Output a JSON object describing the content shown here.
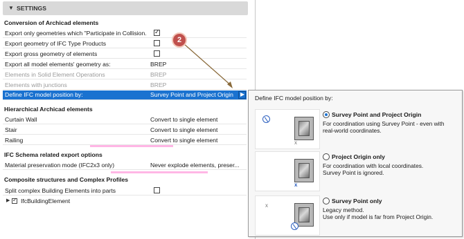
{
  "settings_header": {
    "title": "SETTINGS"
  },
  "groups": {
    "conversion": {
      "title": "Conversion of Archicad elements",
      "rows": [
        {
          "label": "Export only geometries which \"Participate in Collision...",
          "checkbox": true
        },
        {
          "label": "Export geometry of IFC Type Products",
          "checkbox": false
        },
        {
          "label": "Export gross geometry of elements",
          "checkbox": false
        },
        {
          "label": "Export all model elements' geometry as:",
          "value": "BREP"
        },
        {
          "label": "Elements in Solid Element Operations",
          "value": "BREP"
        },
        {
          "label": "Elements with junctions",
          "value": "BREP"
        },
        {
          "label": "Define IFC model position by:",
          "value": "Survey Point and Project Origin"
        }
      ]
    },
    "hierarchical": {
      "title": "Hierarchical Archicad elements",
      "rows": [
        {
          "label": "Curtain Wall",
          "value": "Convert to single element"
        },
        {
          "label": "Stair",
          "value": "Convert to single element"
        },
        {
          "label": "Railing",
          "value": "Convert to single element"
        }
      ]
    },
    "schema": {
      "title": "IFC Schema related export options",
      "rows": [
        {
          "label": "Material preservation mode (IFC2x3 only)",
          "value": "Never explode elements, preser..."
        }
      ]
    },
    "composite": {
      "title": "Composite structures and Complex Profiles",
      "rows": [
        {
          "label": "Split complex Building Elements into parts",
          "checkbox": false
        },
        {
          "label": "IfcBuildingElement",
          "checkbox": true
        }
      ]
    }
  },
  "callout": {
    "number": "2"
  },
  "popup": {
    "title": "Define IFC model position by:",
    "options": [
      {
        "label": "Survey Point and Project Origin",
        "selected": true,
        "desc_1": "For coordination using Survey Point - even with",
        "desc_2": "real-world coordinates."
      },
      {
        "label": "Project Origin only",
        "selected": false,
        "desc_1": "For coordination with local coordinates.",
        "desc_2": "Survey Point is ignored."
      },
      {
        "label": "Survey Point only",
        "selected": false,
        "desc_1": "Legacy method.",
        "desc_2": "Use only if model is far from Project Origin."
      }
    ],
    "origin_marker": "x"
  },
  "icons": {
    "collapse": "triangle-down-icon",
    "expand": "triangle-right-icon",
    "checkmark": "check-icon",
    "survey_point": "survey-point-icon",
    "project_origin": "project-origin-icon"
  },
  "colors": {
    "selection": "#1a72d0",
    "callout": "#c0504d",
    "annotation_arrow": "#8a6a3a",
    "origin_blue": "#2b5fbf"
  }
}
